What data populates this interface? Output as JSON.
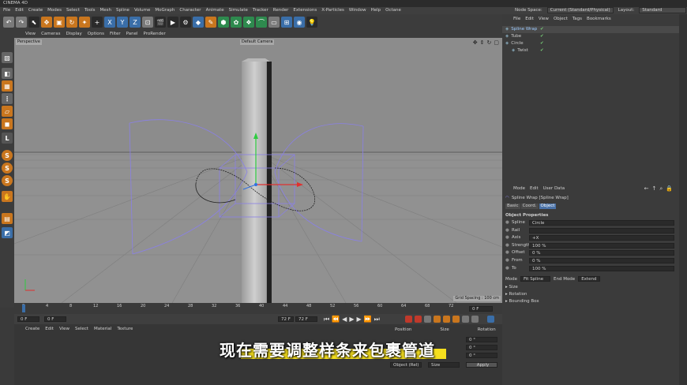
{
  "app": {
    "title": "CINEMA 4D"
  },
  "menu": [
    "File",
    "Edit",
    "Create",
    "Modes",
    "Select",
    "Tools",
    "Mesh",
    "Spline",
    "Volume",
    "MoGraph",
    "Character",
    "Animate",
    "Simulate",
    "Tracker",
    "Render",
    "Extensions",
    "X-Particles",
    "Window",
    "Help",
    "Octane"
  ],
  "nodespace": {
    "label": "Node Space:",
    "value": "Current (Standard/Physical)",
    "layout_label": "Layout:",
    "layout_value": "Standard"
  },
  "viewport": {
    "menu": [
      "View",
      "Cameras",
      "Display",
      "Options",
      "Filter",
      "Panel",
      "ProRender"
    ],
    "name": "Perspective",
    "camera": "Default Camera",
    "grid_spacing": "Grid Spacing : 100 cm"
  },
  "timeline": {
    "ticks": [
      "0",
      "4",
      "8",
      "12",
      "16",
      "20",
      "24",
      "28",
      "32",
      "36",
      "40",
      "44",
      "48",
      "52",
      "56",
      "60",
      "64",
      "68",
      "72"
    ],
    "current": "0 F"
  },
  "transport": {
    "start": "0 F",
    "field2": "0 F",
    "end": "72 F",
    "end2": "72 F"
  },
  "materials": {
    "menu": [
      "Create",
      "Edit",
      "View",
      "Select",
      "Material",
      "Texture"
    ]
  },
  "coords": {
    "headers": [
      "Position",
      "Size",
      "Rotation"
    ],
    "rows": [
      {
        "val": "0 °"
      },
      {
        "val": "0 °"
      },
      {
        "val": "0 °"
      }
    ],
    "mode1": "Object (Rel)",
    "mode2": "Size",
    "apply": "Apply"
  },
  "objects": {
    "menu": [
      "File",
      "Edit",
      "View",
      "Object",
      "Tags",
      "Bookmarks"
    ],
    "items": [
      {
        "name": "Spline Wrap",
        "indent": 0
      },
      {
        "name": "Tube",
        "indent": 0
      },
      {
        "name": "Circle",
        "indent": 0
      },
      {
        "name": "Twist",
        "indent": 1
      }
    ]
  },
  "attributes": {
    "menu": [
      "Mode",
      "Edit",
      "User Data"
    ],
    "header": "Spline Wrap [Spline Wrap]",
    "tabs": [
      "Basic",
      "Coord.",
      "Object"
    ],
    "section": "Object Properties",
    "props": [
      {
        "label": "Spline",
        "value": "Circle"
      },
      {
        "label": "Rail",
        "value": ""
      },
      {
        "label": "Axis",
        "value": "+X"
      },
      {
        "label": "Strength",
        "value": "100 %"
      },
      {
        "label": "Offset",
        "value": "0 %"
      },
      {
        "label": "From",
        "value": "0 %"
      },
      {
        "label": "To",
        "value": "100 %"
      }
    ],
    "mode_label": "Mode",
    "mode_value": "Fit Spline",
    "end_mode_label": "End Mode",
    "end_mode_value": "Extend",
    "groups": [
      "Size",
      "Rotation",
      "Bounding Box"
    ]
  },
  "subtitle": "现在需要调整样条来包裹管道",
  "colors": {
    "accent": "#c9761e",
    "highlight": "#f5df1e",
    "viewport_bg": "#8e8e8e",
    "spline": "#8a80e6"
  }
}
